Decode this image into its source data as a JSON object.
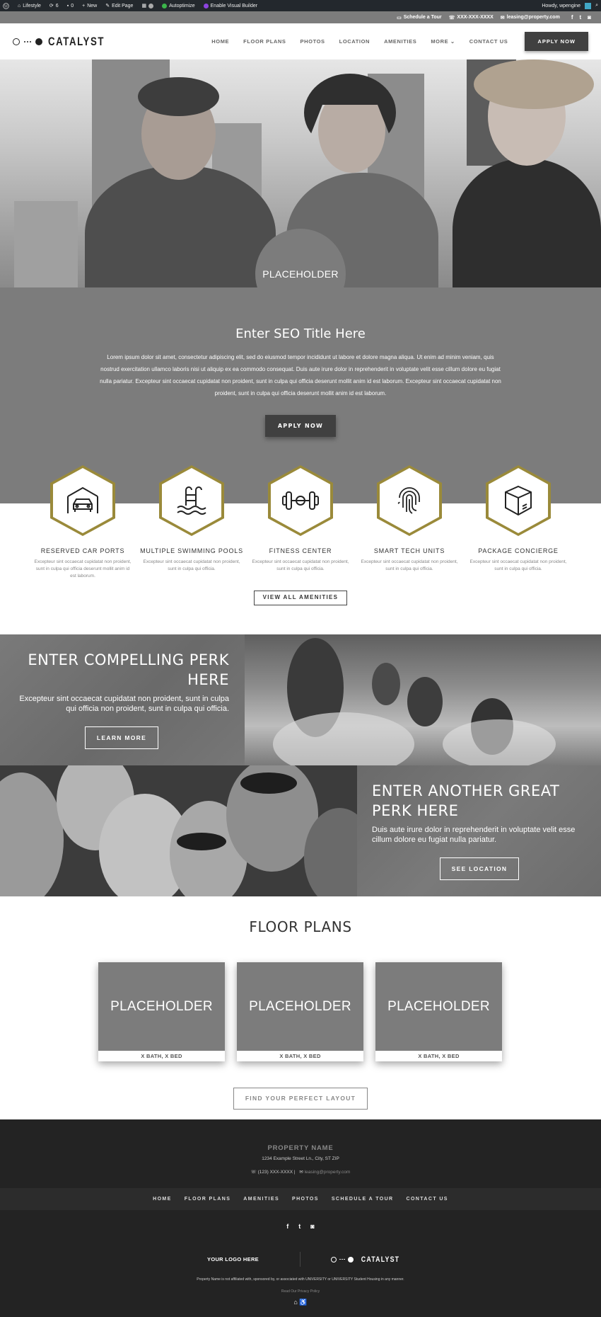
{
  "admin_bar": {
    "site_name": "Lifestyle",
    "updates_count": "6",
    "comments_count": "0",
    "new_label": "New",
    "edit_page_label": "Edit Page",
    "autoptimize_label": "Autoptimize",
    "visual_builder_label": "Enable Visual Builder",
    "greeting": "Howdy, wpengine"
  },
  "utility_bar": {
    "tour_label": "Schedule a Tour",
    "phone": "XXX-XXX-XXXX",
    "email": "leasing@property.com"
  },
  "header": {
    "logo_text": "CATALYST",
    "nav": [
      "HOME",
      "FLOOR PLANS",
      "PHOTOS",
      "LOCATION",
      "AMENITIES",
      "MORE",
      "CONTACT US"
    ],
    "apply_label": "APPLY NOW"
  },
  "hero": {
    "placeholder_label": "PLACEHOLDER"
  },
  "seo": {
    "title": "Enter SEO Title Here",
    "body": "Lorem ipsum dolor sit amet, consectetur adipiscing elit, sed do eiusmod tempor incididunt ut labore et dolore magna aliqua. Ut enim ad minim veniam, quis nostrud exercitation ullamco laboris nisi ut aliquip ex ea commodo consequat. Duis aute irure dolor in reprehenderit in voluptate velit esse cillum dolore eu fugiat nulla pariatur. Excepteur sint occaecat cupidatat non proident, sunt in culpa qui officia deserunt mollit anim id est laborum. Excepteur sint occaecat cupidatat non proident, sunt in culpa qui officia deserunt mollit anim id est laborum.",
    "apply_label": "APPLY NOW"
  },
  "amenities": {
    "items": [
      {
        "title": "RESERVED CAR PORTS",
        "text": "Excepteur sint occaecat cupidatat non proident, sunt in culpa qui officia deserunt mollit anim id est laborum.",
        "icon": "car-icon"
      },
      {
        "title": "MULTIPLE SWIMMING POOLS",
        "text": "Excepteur sint occaecat cupidatat non proident, sunt in culpa qui officia.",
        "icon": "pool-ladder-icon"
      },
      {
        "title": "FITNESS CENTER",
        "text": "Excepteur sint occaecat cupidatat non proident, sunt in culpa qui officia.",
        "icon": "dumbbell-icon"
      },
      {
        "title": "SMART TECH UNITS",
        "text": "Excepteur sint occaecat cupidatat non proident, sunt in culpa qui officia.",
        "icon": "fingerprint-icon"
      },
      {
        "title": "PACKAGE CONCIERGE",
        "text": "Excepteur sint occaecat cupidatat non proident, sunt in culpa qui officia.",
        "icon": "package-box-icon"
      }
    ],
    "view_all_label": "VIEW ALL AMENITIES",
    "accent_color": "#9a8a3a"
  },
  "perks": {
    "perk1": {
      "title": "ENTER COMPELLING PERK HERE",
      "text": "Excepteur sint occaecat cupidatat non proident, sunt in culpa qui officia non proident, sunt in culpa qui officia.",
      "button": "LEARN MORE"
    },
    "perk2": {
      "title": "ENTER ANOTHER GREAT PERK HERE",
      "text": "Duis aute irure dolor in reprehenderit in voluptate velit esse cillum dolore eu fugiat nulla pariatur.",
      "button": "SEE LOCATION"
    }
  },
  "floor_plans": {
    "title": "FLOOR PLANS",
    "cards": [
      {
        "image_label": "PLACEHOLDER",
        "caption": "X BATH, X BED"
      },
      {
        "image_label": "PLACEHOLDER",
        "caption": "X BATH, X BED"
      },
      {
        "image_label": "PLACEHOLDER",
        "caption": "X BATH, X BED"
      }
    ],
    "button_label": "FIND YOUR PERFECT LAYOUT"
  },
  "footer": {
    "property_name": "PROPERTY NAME",
    "address": "1234 Example Street Ln., City, ST ZIP",
    "phone": "(123) XXX-XXXX",
    "separator": "|",
    "email": "leasing@property.com",
    "nav": [
      "HOME",
      "FLOOR PLANS",
      "AMENITIES",
      "PHOTOS",
      "SCHEDULE A TOUR",
      "CONTACT US"
    ],
    "your_logo": "YOUR LOGO HERE",
    "logo_text": "CATALYST",
    "disclaimer": "Property Name is not affiliated with, sponsored by, or associated with UNIVERSITY or UNIVERSITY Student Housing in any manner.",
    "privacy_label": "Read Our Privacy Policy"
  }
}
